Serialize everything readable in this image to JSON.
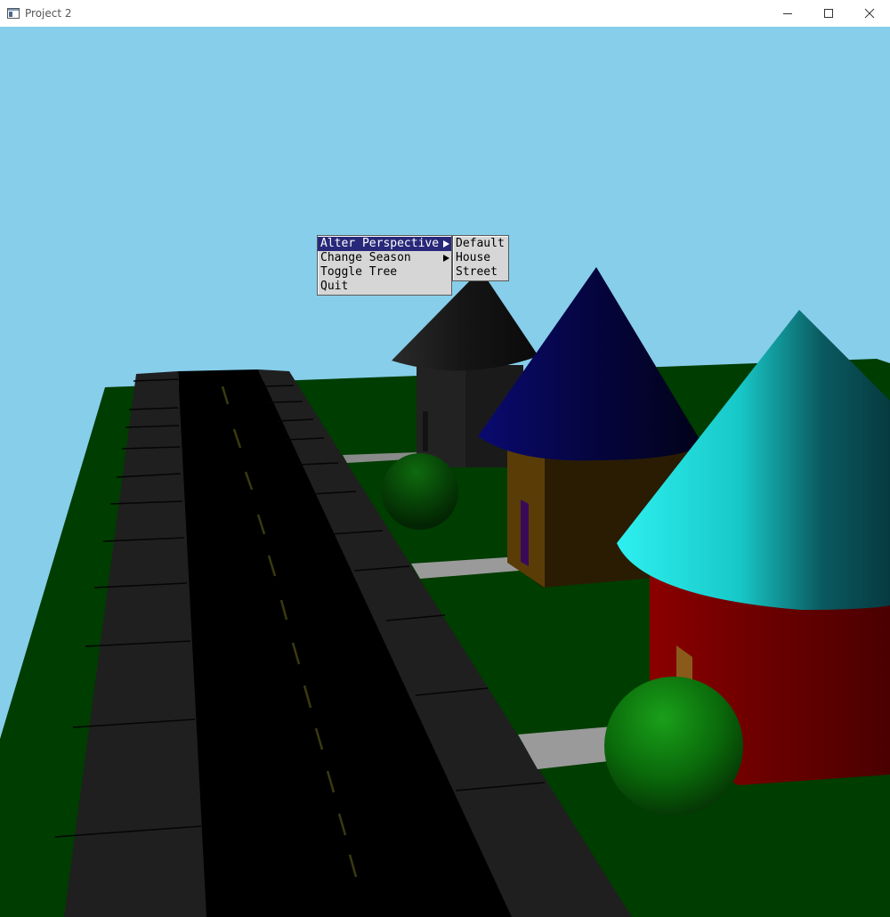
{
  "window": {
    "title": "Project 2",
    "app_icon": "window-app-icon",
    "controls": {
      "minimize_icon": "minimize-icon",
      "maximize_icon": "maximize-icon",
      "close_icon": "close-icon"
    }
  },
  "scene": {
    "colors": {
      "sky": "#87ceeb",
      "grass": "#003d00",
      "road": "#000000",
      "sidewalk": "#1f1f1f",
      "lane_line": "#3a3a10",
      "path": "#9a9a9a",
      "house_far_roof": "#1a1a1a",
      "house_mid_roof": "#0a0a55",
      "house_mid_wall": "#5a3d06",
      "house_near_roof": "#1fb8b8",
      "house_near_wall": "#7a0000",
      "bush": "#0a7a0a",
      "door_mid": "#3a0a5a",
      "door_near": "#8a5a1a"
    }
  },
  "context_menu": {
    "items": [
      {
        "label": "Alter Perspective",
        "has_submenu": true,
        "active": true
      },
      {
        "label": "Change Season",
        "has_submenu": true,
        "active": false
      },
      {
        "label": "Toggle Tree",
        "has_submenu": false,
        "active": false
      },
      {
        "label": "Quit",
        "has_submenu": false,
        "active": false
      }
    ]
  },
  "perspective_submenu": {
    "items": [
      {
        "label": "Default"
      },
      {
        "label": "House"
      },
      {
        "label": "Street"
      }
    ]
  }
}
